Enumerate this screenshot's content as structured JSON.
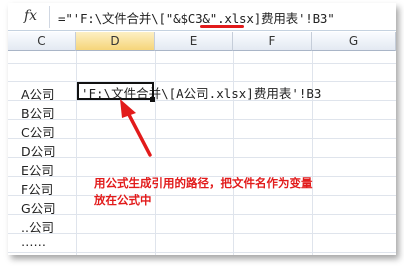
{
  "formula_bar": {
    "fx_icon": "fx-icon",
    "formula": "=\"'F:\\文件合并\\[\"&$C3&\".xlsx]费用表'!B3\""
  },
  "columns": [
    "C",
    "D",
    "E",
    "F",
    "G"
  ],
  "active_column": "D",
  "rows": [
    {
      "c": "A公司",
      "d": "'F:\\文件合并\\[A公司.xlsx]费用表'!B3"
    },
    {
      "c": "B公司",
      "d": ""
    },
    {
      "c": "C公司",
      "d": ""
    },
    {
      "c": "D公司",
      "d": ""
    },
    {
      "c": "E公司",
      "d": ""
    },
    {
      "c": "F公司",
      "d": ""
    },
    {
      "c": "G公司",
      "d": ""
    },
    {
      "c": "..公司",
      "d": ""
    },
    {
      "c": "……",
      "d": ""
    }
  ],
  "annotation": {
    "line1": "用公式生成引用的路径，把文件名作为变量",
    "line2": "放在公式中",
    "color": "#e21b1b"
  }
}
